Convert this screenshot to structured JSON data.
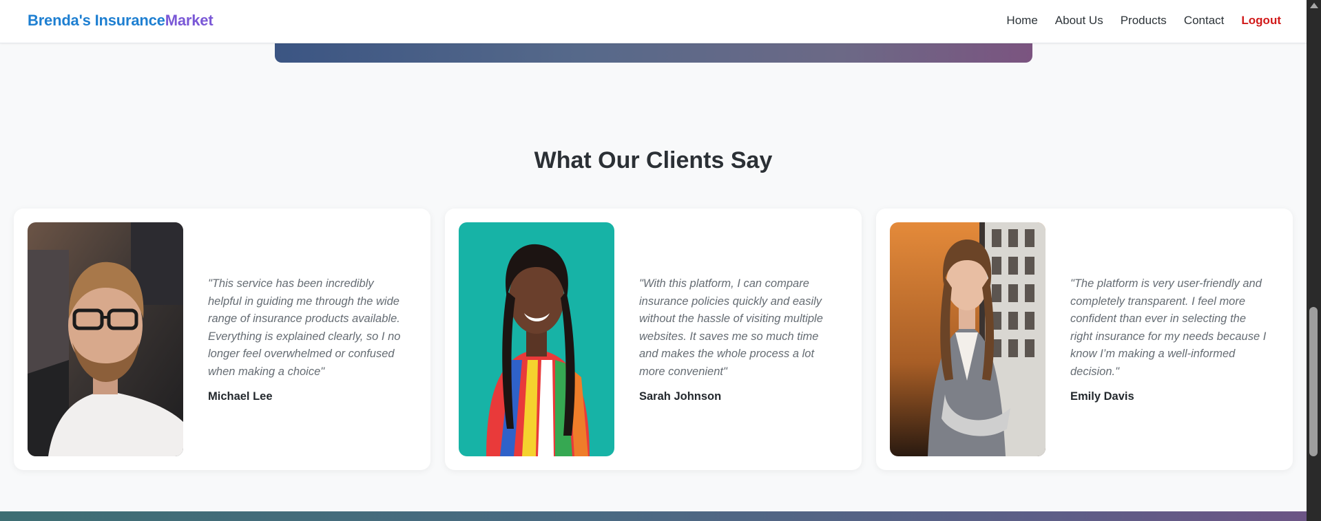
{
  "nav": {
    "brand_part1": "Brenda's Insurance",
    "brand_part2": "Market",
    "links": [
      "Home",
      "About Us",
      "Products",
      "Contact"
    ],
    "logout": "Logout"
  },
  "testimonials": {
    "title": "What Our Clients Say",
    "items": [
      {
        "quote": "\"This service has been incredibly helpful in guiding me through the wide range of insurance products available. Everything is explained clearly, so I no longer feel overwhelmed or confused when making a choice\"",
        "name": "Michael Lee"
      },
      {
        "quote": "\"With this platform, I can compare insurance policies quickly and easily without the hassle of visiting multiple websites. It saves me so much time and makes the whole process a lot more convenient\"",
        "name": "Sarah Johnson"
      },
      {
        "quote": "\"The platform is very user-friendly and completely transparent. I feel more confident than ever in selecting the right insurance for my needs because I know I’m making a well-informed decision.\"",
        "name": "Emily Davis"
      }
    ]
  },
  "colors": {
    "brand_blue": "#1e7fd1",
    "brand_purple": "#7a58d6",
    "logout_red": "#d11a1a"
  }
}
